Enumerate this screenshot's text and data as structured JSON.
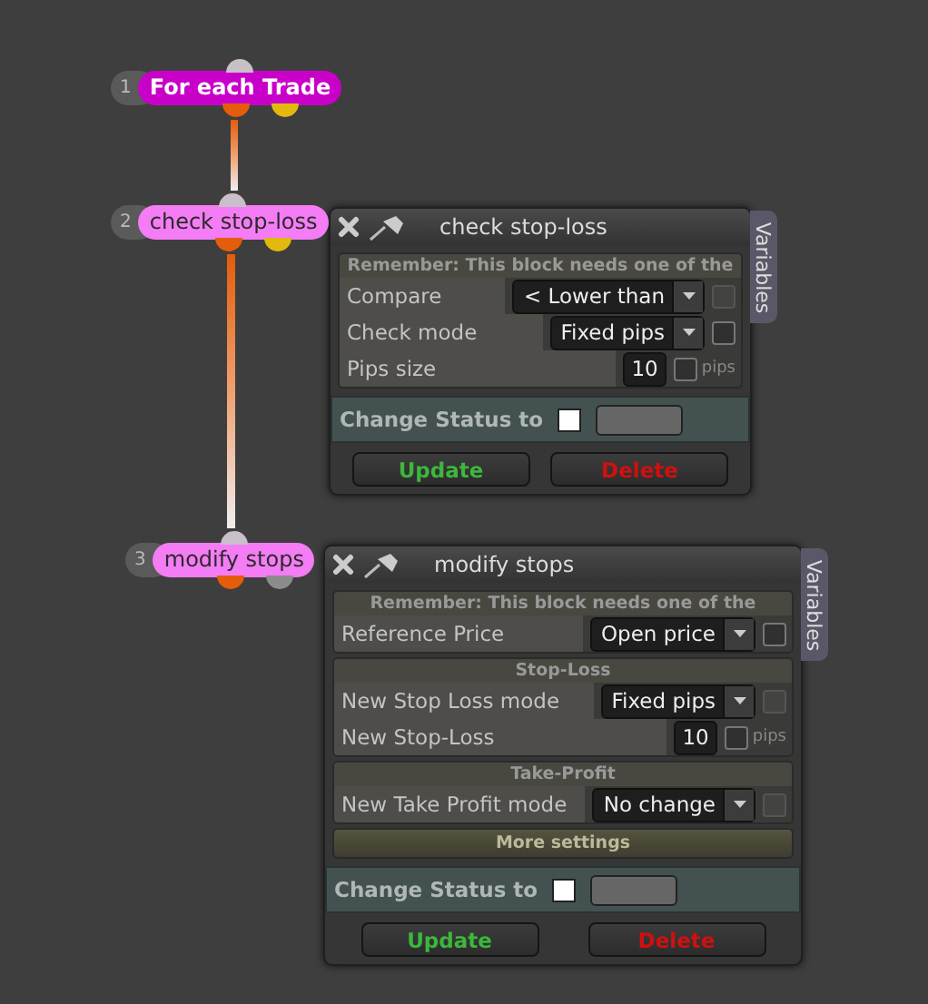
{
  "nodes": [
    {
      "number": "1",
      "label": "For each Trade",
      "color": "#c800c8",
      "ports": [
        {
          "color": "#e35d0a"
        },
        {
          "color": "#e2b90c"
        }
      ]
    },
    {
      "number": "2",
      "label": "check stop-loss",
      "color": "#f47cf4",
      "ports": [
        {
          "color": "#e35d0a"
        },
        {
          "color": "#e2b90c"
        }
      ]
    },
    {
      "number": "3",
      "label": "modify stops",
      "color": "#f47cf4",
      "ports": [
        {
          "color": "#e35d0a"
        },
        {
          "color": "#8c8c8c"
        }
      ]
    }
  ],
  "panels": [
    {
      "title": "check stop-loss",
      "side_tab": "Variables",
      "rows": [
        {
          "kind": "notice",
          "text": "Remember: This block needs one of the"
        },
        {
          "kind": "select",
          "label": "Compare",
          "value": "< Lower than",
          "checkbox": {
            "checked": false,
            "disabled": true
          }
        },
        {
          "kind": "select",
          "label": "Check mode",
          "value": "Fixed pips",
          "checkbox": {
            "checked": false,
            "disabled": false
          }
        },
        {
          "kind": "number",
          "label": "Pips size",
          "value": "10",
          "unit": "pips",
          "checkbox": {
            "checked": false,
            "disabled": false
          }
        }
      ],
      "status": {
        "label": "Change Status to",
        "checked": false
      },
      "buttons": [
        {
          "label": "Update",
          "kind": "update"
        },
        {
          "label": "Delete",
          "kind": "delete"
        }
      ]
    },
    {
      "title": "modify stops",
      "side_tab": "Variables",
      "rows": [
        {
          "kind": "notice",
          "text": "Remember: This block needs one of the"
        },
        {
          "kind": "select",
          "label": "Reference Price",
          "value": "Open price",
          "checkbox": {
            "checked": false,
            "disabled": false
          }
        },
        {
          "kind": "heading",
          "text": "Stop-Loss"
        },
        {
          "kind": "select",
          "label": "New Stop Loss mode",
          "value": "Fixed pips",
          "checkbox": {
            "checked": false,
            "disabled": true
          }
        },
        {
          "kind": "number",
          "label": "New Stop-Loss",
          "value": "10",
          "unit": "pips",
          "checkbox": {
            "checked": false,
            "disabled": false
          }
        },
        {
          "kind": "heading",
          "text": "Take-Profit"
        },
        {
          "kind": "select",
          "label": "New Take Profit mode",
          "value": "No change",
          "checkbox": {
            "checked": false,
            "disabled": true
          }
        },
        {
          "kind": "collapsed",
          "text": "More settings"
        }
      ],
      "status": {
        "label": "Change Status to",
        "checked": false
      },
      "buttons": [
        {
          "label": "Update",
          "kind": "update"
        },
        {
          "label": "Delete",
          "kind": "delete"
        }
      ]
    }
  ]
}
